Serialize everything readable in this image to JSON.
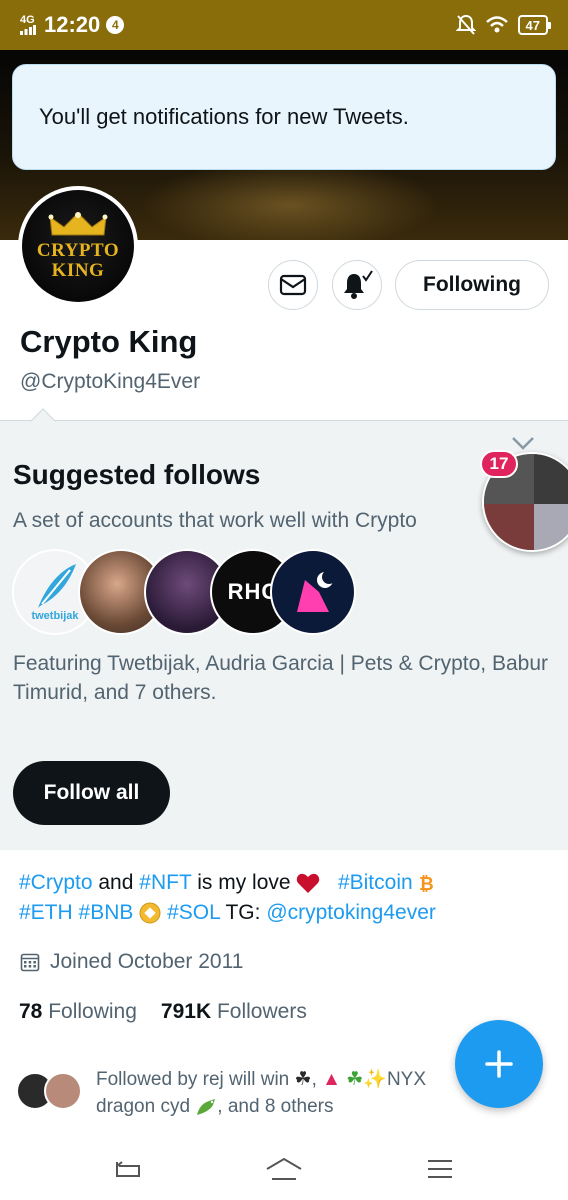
{
  "status_bar": {
    "network": "4G",
    "time": "12:20",
    "notification_count": "4",
    "battery": "47"
  },
  "toast": {
    "message": "You'll get notifications for new Tweets."
  },
  "profile": {
    "avatar_text_line1": "CRYPTO",
    "avatar_text_line2": "KING",
    "name": "Crypto King",
    "handle": "@CryptoKing4Ever",
    "following_button": "Following",
    "bio": {
      "tag1": "#Crypto",
      "and": "and",
      "tag2": "#NFT",
      "is_my_love": "is my love",
      "tag3": "#Bitcoin",
      "tag4": "#ETH",
      "tag5": "#BNB",
      "tag6": "#SOL",
      "tg": "TG:",
      "mention": "@cryptoking4ever"
    },
    "joined": "Joined October 2011",
    "following_count": "78",
    "following_label": "Following",
    "followers_count": "791K",
    "followers_label": "Followers",
    "followed_by_pre": "Followed by rej will win",
    "followed_by_mid": "NYX",
    "followed_by_post": "dragon cyd",
    "followed_by_end": ", and 8 others"
  },
  "suggested": {
    "title": "Suggested follows",
    "subtitle": "A set of accounts that work well with Crypto",
    "avatar3_text": "RHC",
    "avatar1_text": "twetbijak",
    "featuring": "Featuring Twetbijak, Audria Garcia | Pets & Crypto, Babur Timurid, and 7 others.",
    "follow_all": "Follow all"
  },
  "bubble": {
    "count": "17"
  },
  "colors": {
    "accent": "#1d9bf0",
    "status_bar": "#8a6d0b",
    "badge": "#e0245e"
  }
}
